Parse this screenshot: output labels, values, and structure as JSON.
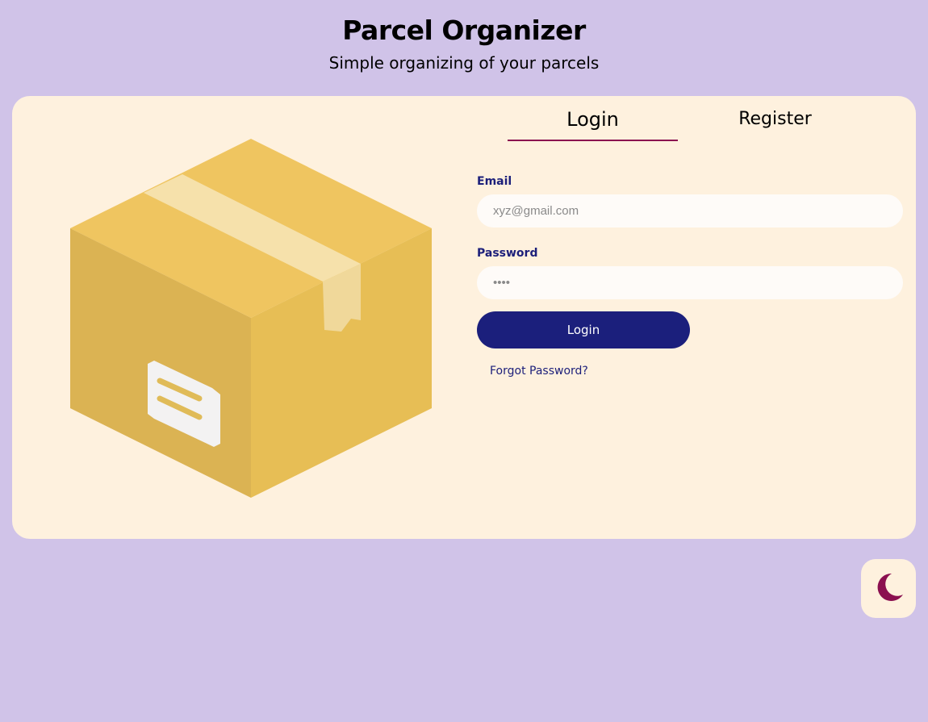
{
  "header": {
    "title": "Parcel Organizer",
    "subtitle": "Simple organizing of your parcels"
  },
  "tabs": [
    {
      "label": "Login",
      "active": true
    },
    {
      "label": "Register",
      "active": false
    }
  ],
  "form": {
    "email": {
      "label": "Email",
      "placeholder": "xyz@gmail.com",
      "value": ""
    },
    "password": {
      "label": "Password",
      "placeholder": "••••",
      "value": ""
    },
    "submit_label": "Login",
    "forgot_label": "Forgot Password?"
  },
  "illustration": {
    "icon": "cardboard-box-icon"
  },
  "theme_toggle": {
    "icon": "moon-icon"
  },
  "colors": {
    "background": "#d0c3e8",
    "card": "#fef1de",
    "primary": "#1b1f7c",
    "accent": "#8b1050",
    "box_top": "#efc560",
    "box_left": "#dbb353",
    "box_right": "#e7be55",
    "tape": "#f6e1ab"
  }
}
